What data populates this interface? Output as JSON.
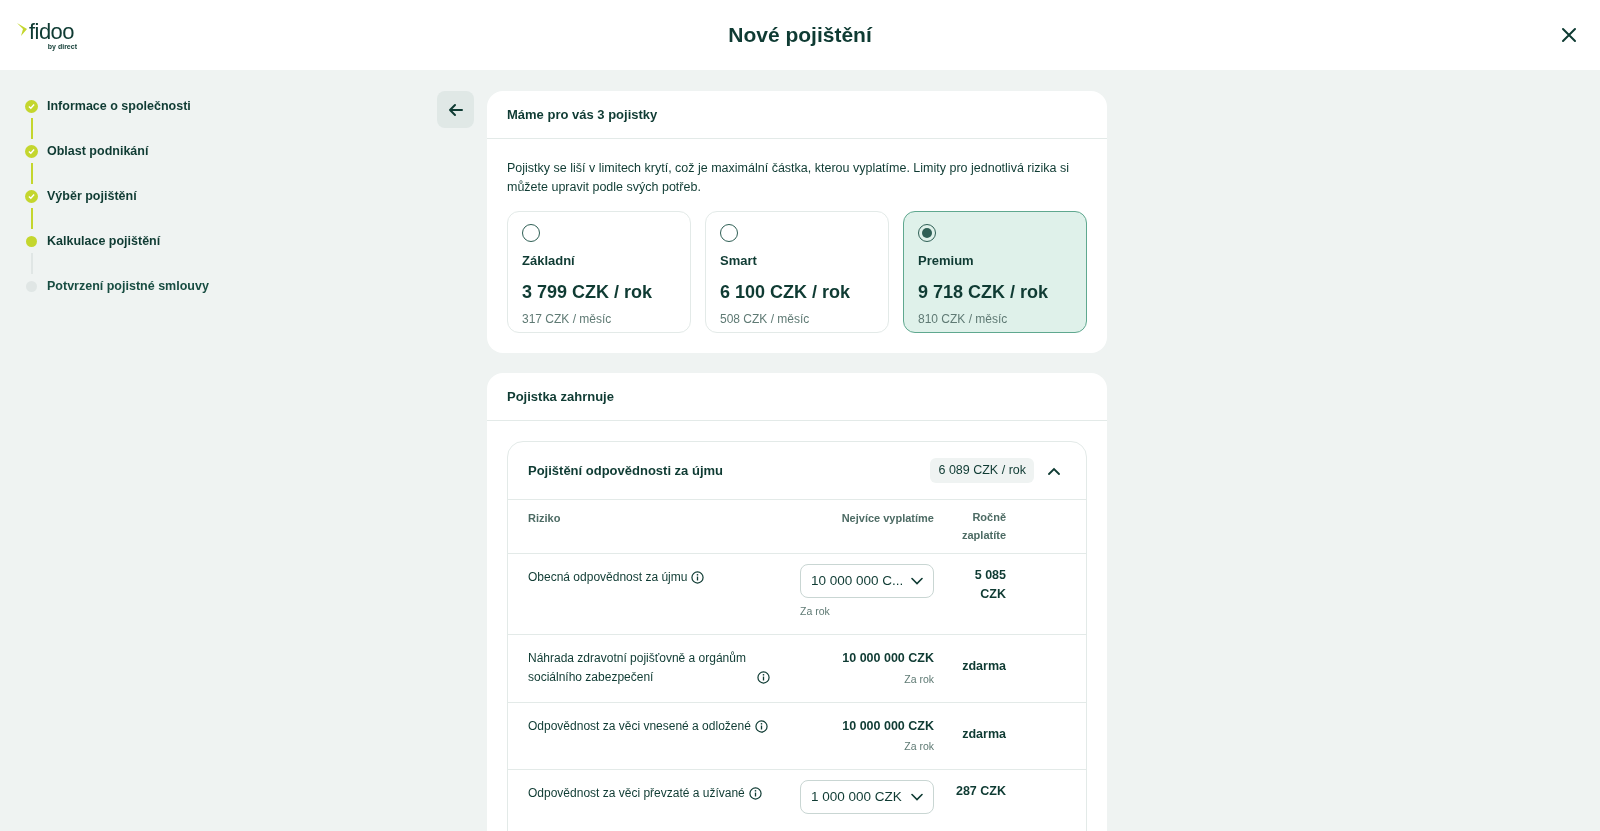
{
  "header": {
    "logo": {
      "wordmark": "fidoo",
      "tagline": "by direct"
    },
    "title": "Nové pojištění"
  },
  "steps": [
    {
      "label": "Informace o společnosti",
      "done": true,
      "current": false
    },
    {
      "label": "Oblast podnikání",
      "done": true,
      "current": false
    },
    {
      "label": "Výběr pojištění",
      "done": true,
      "current": false
    },
    {
      "label": "Kalkulace pojištění",
      "done": false,
      "current": true
    },
    {
      "label": "Potvrzení pojistné smlouvy",
      "done": false,
      "current": false
    }
  ],
  "plans_card": {
    "title": "Máme pro vás 3 pojistky",
    "description": "Pojistky se liší v limitech krytí, což je maximální částka, kterou vyplatíme. Limity pro jednotlivá rizika si můžete upravit podle svých potřeb.",
    "plans": [
      {
        "name": "Základní",
        "price": "3 799 CZK / rok",
        "monthly": "317 CZK / měsíc",
        "selected": false
      },
      {
        "name": "Smart",
        "price": "6 100 CZK / rok",
        "monthly": "508 CZK / měsíc",
        "selected": false
      },
      {
        "name": "Premium",
        "price": "9 718 CZK / rok",
        "monthly": "810 CZK / měsíc",
        "selected": true
      }
    ]
  },
  "coverage_card": {
    "title": "Pojistka zahrnuje",
    "section": {
      "title": "Pojištění odpovědnosti za újmu",
      "total": "6 089 CZK / rok",
      "expanded": true,
      "columns": [
        "Riziko",
        "Nejvíce vyplatíme",
        "Ročně zaplatíte"
      ],
      "rows": [
        {
          "kind": "select",
          "risk": "Obecná odpovědnost za újmu",
          "limit": "10 000 000 C...",
          "dropdown_hint": "Za rok",
          "price": "5 085 CZK"
        },
        {
          "kind": "fixed",
          "risk": "Náhrada zdravotní pojišťovně a orgánům sociálního zabezpečení",
          "limit": "10 000 000 CZK",
          "period": "Za rok",
          "price": "zdarma"
        },
        {
          "kind": "fixed",
          "risk": "Odpovědnost za věci vnesené a odložené",
          "limit": "10 000 000 CZK",
          "period": "Za rok",
          "price": "zdarma"
        },
        {
          "kind": "select",
          "risk": "Odpovědnost za věci převzaté a užívané",
          "limit": "1 000 000 CZK",
          "price": "287 CZK"
        }
      ]
    }
  }
}
